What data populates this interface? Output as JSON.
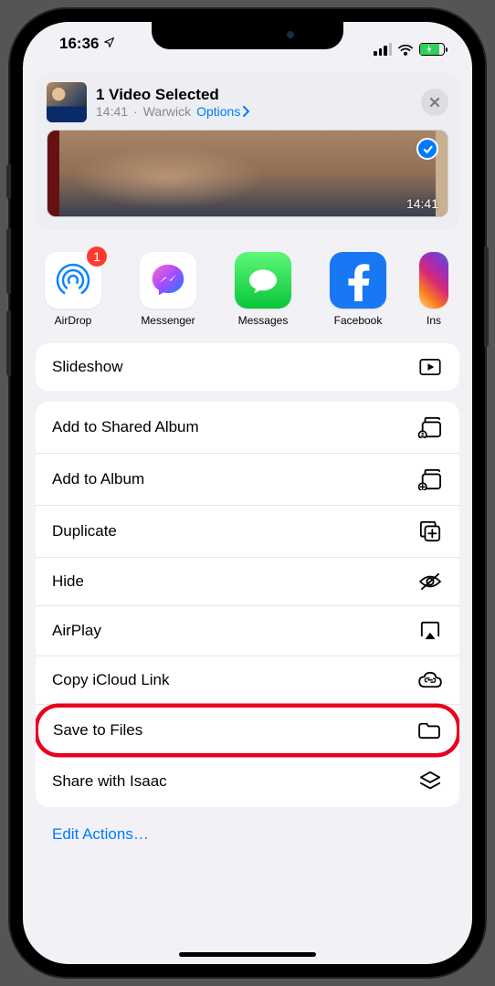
{
  "status": {
    "time": "16:36"
  },
  "header": {
    "title": "1 Video Selected",
    "time": "14:41",
    "location": "Warwick",
    "options_label": "Options"
  },
  "preview": {
    "duration": "14:41"
  },
  "apps": [
    {
      "name": "AirDrop",
      "badge": "1"
    },
    {
      "name": "Messenger"
    },
    {
      "name": "Messages"
    },
    {
      "name": "Facebook"
    },
    {
      "name": "Ins"
    }
  ],
  "actions_top": [
    {
      "label": "Slideshow",
      "icon": "play"
    }
  ],
  "actions": [
    {
      "label": "Add to Shared Album",
      "icon": "album-shared"
    },
    {
      "label": "Add to Album",
      "icon": "album-add"
    },
    {
      "label": "Duplicate",
      "icon": "duplicate"
    },
    {
      "label": "Hide",
      "icon": "hide"
    },
    {
      "label": "AirPlay",
      "icon": "airplay"
    },
    {
      "label": "Copy iCloud Link",
      "icon": "cloud-link"
    },
    {
      "label": "Save to Files",
      "icon": "folder",
      "highlight": true
    },
    {
      "label": "Share with Isaac",
      "icon": "stack"
    }
  ],
  "footer": {
    "edit": "Edit Actions…"
  }
}
